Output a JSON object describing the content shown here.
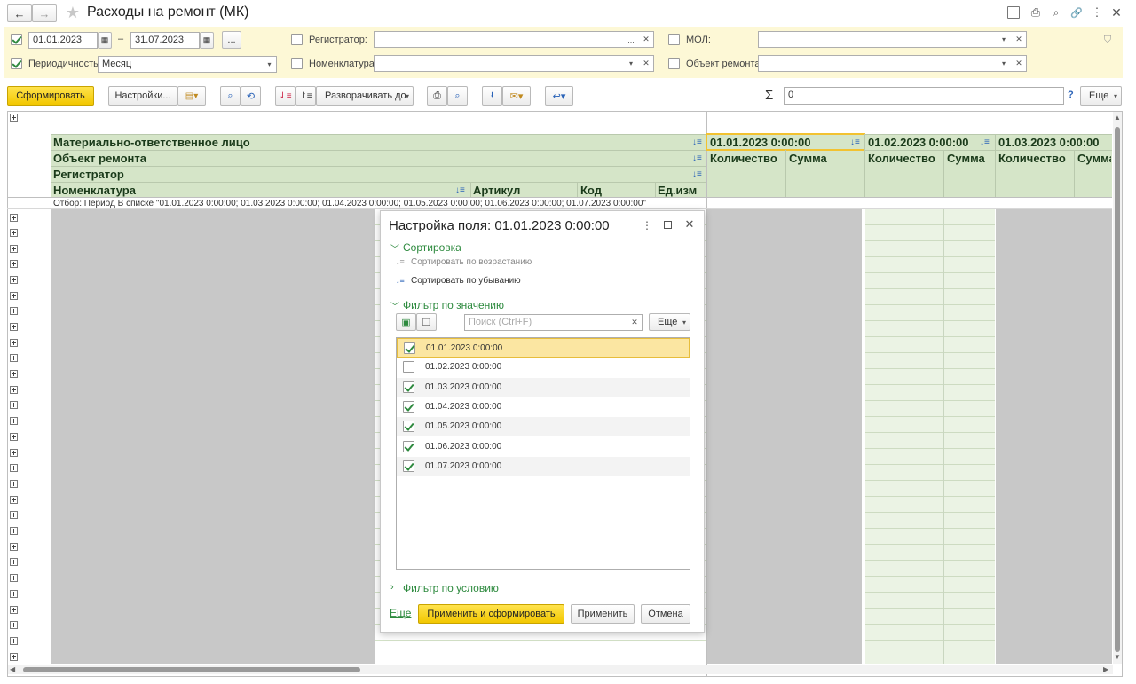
{
  "window": {
    "title": "Расходы на ремонт (МК)"
  },
  "filters": {
    "date_from": "01.01.2023",
    "date_sep": "–",
    "date_to": "31.07.2023",
    "period_btn": "...",
    "periodicity_label": "Периодичность:",
    "periodicity_value": "Месяц",
    "registrar_label": "Регистратор:",
    "nomenclature_label": "Номенклатура:",
    "mol_label": "МОЛ:",
    "repair_object_label": "Объект ремонта:"
  },
  "toolbar": {
    "generate": "Сформировать",
    "settings": "Настройки...",
    "expand_to": "Разворачивать до",
    "sum_symbol": "Σ",
    "sum_value": "0",
    "help": "?",
    "more": "Еще"
  },
  "report": {
    "row_headers": [
      "Материально-ответственное лицо",
      "Объект ремонта",
      "Регистратор"
    ],
    "nomenclature": "Номенклатура",
    "article": "Артикул",
    "code": "Код",
    "unit": "Ед.изм",
    "periods": [
      "01.01.2023 0:00:00",
      "01.02.2023 0:00:00",
      "01.03.2023 0:00:00"
    ],
    "qty": "Количество",
    "sum": "Сумма",
    "filter_note": "Отбор: Период В списке \"01.01.2023 0:00:00; 01.03.2023 0:00:00; 01.04.2023 0:00:00; 01.05.2023 0:00:00; 01.06.2023 0:00:00; 01.07.2023 0:00:00\""
  },
  "dialog": {
    "title": "Настройка поля: 01.01.2023 0:00:00",
    "sort_section": "Сортировка",
    "sort_asc": "Сортировать по возрастанию",
    "sort_desc": "Сортировать по убыванию",
    "filter_value_section": "Фильтр по значению",
    "search_placeholder": "Поиск (Ctrl+F)",
    "more": "Еще",
    "items": [
      {
        "label": "01.01.2023 0:00:00",
        "checked": true
      },
      {
        "label": "01.02.2023 0:00:00",
        "checked": false
      },
      {
        "label": "01.03.2023 0:00:00",
        "checked": true
      },
      {
        "label": "01.04.2023 0:00:00",
        "checked": true
      },
      {
        "label": "01.05.2023 0:00:00",
        "checked": true
      },
      {
        "label": "01.06.2023 0:00:00",
        "checked": true
      },
      {
        "label": "01.07.2023 0:00:00",
        "checked": true
      }
    ],
    "filter_condition_section": "Фильтр по условию",
    "more_link": "Еще",
    "apply_generate": "Применить и сформировать",
    "apply": "Применить",
    "cancel": "Отмена"
  },
  "colors": {
    "accent_yellow": "#f5d000",
    "panel_yellow": "#fdf8d6",
    "header_green": "#d5e5c8",
    "link_green": "#2d8a3e"
  }
}
